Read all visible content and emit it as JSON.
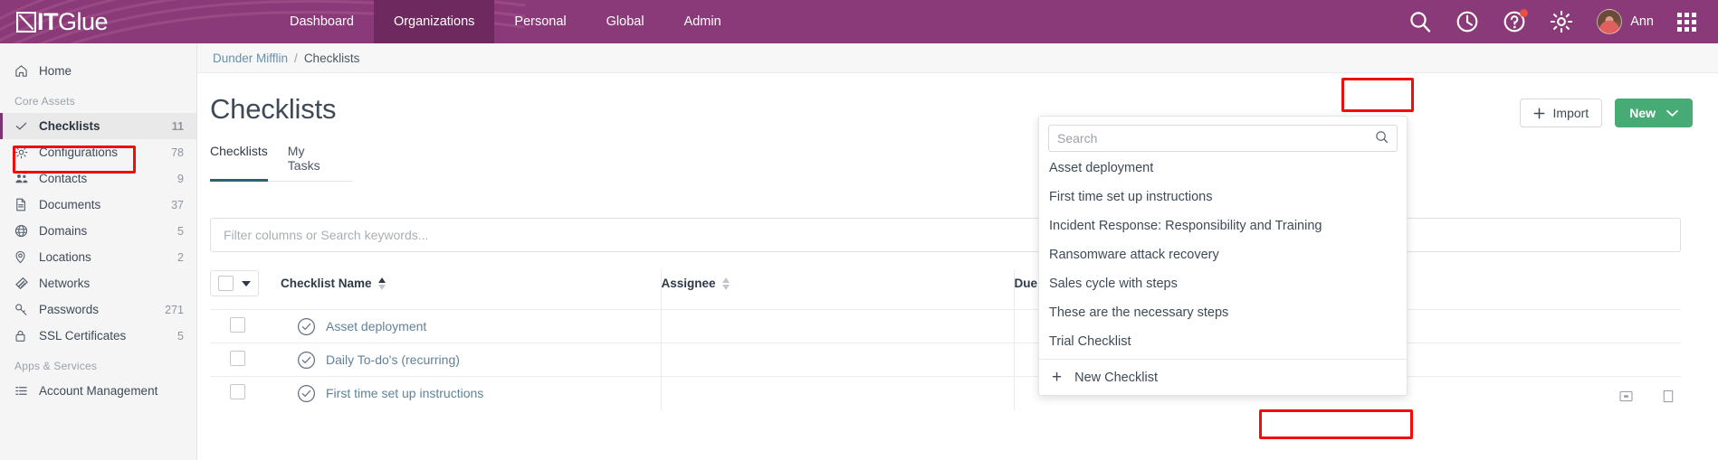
{
  "brand": {
    "name_bold": "IT",
    "name_light": "Glue",
    "accent": "#8a3a78",
    "accent_active": "#6e2a5f",
    "green": "#47ab76",
    "highlight": "#f20d0d"
  },
  "topnav": {
    "items": [
      {
        "label": "Dashboard",
        "active": false
      },
      {
        "label": "Organizations",
        "active": true
      },
      {
        "label": "Personal",
        "active": false
      },
      {
        "label": "Global",
        "active": false
      },
      {
        "label": "Admin",
        "active": false
      }
    ],
    "icons": [
      "search-icon",
      "history-icon",
      "help-icon",
      "gear-icon",
      "apps-grid-icon"
    ],
    "user_name": "Ann"
  },
  "sidebar": {
    "home": {
      "label": "Home",
      "icon": "home-icon"
    },
    "sections": [
      {
        "title": "Core Assets",
        "items": [
          {
            "label": "Checklists",
            "count": "11",
            "icon": "check-icon",
            "active": true
          },
          {
            "label": "Configurations",
            "count": "78",
            "icon": "gear-icon",
            "active": false
          },
          {
            "label": "Contacts",
            "count": "9",
            "icon": "contacts-icon",
            "active": false
          },
          {
            "label": "Documents",
            "count": "37",
            "icon": "document-icon",
            "active": false
          },
          {
            "label": "Domains",
            "count": "5",
            "icon": "globe-icon",
            "active": false
          },
          {
            "label": "Locations",
            "count": "2",
            "icon": "pin-icon",
            "active": false
          },
          {
            "label": "Networks",
            "count": "",
            "icon": "network-icon",
            "active": false
          },
          {
            "label": "Passwords",
            "count": "271",
            "icon": "key-icon",
            "active": false
          },
          {
            "label": "SSL Certificates",
            "count": "5",
            "icon": "lock-icon",
            "active": false
          }
        ]
      },
      {
        "title": "Apps & Services",
        "items": [
          {
            "label": "Account Management",
            "count": "",
            "icon": "list-icon",
            "active": false
          }
        ]
      }
    ]
  },
  "breadcrumb": {
    "org": "Dunder Mifflin",
    "separator": "/",
    "current": "Checklists"
  },
  "page": {
    "title": "Checklists"
  },
  "toolbar": {
    "import_label": "Import",
    "new_label": "New"
  },
  "tabs": [
    {
      "label": "Checklists",
      "active": true
    },
    {
      "label": "My Tasks",
      "active": false
    }
  ],
  "filter": {
    "placeholder": "Filter columns or Search keywords..."
  },
  "table": {
    "headers": [
      "Checklist Name",
      "Assignee",
      "Due"
    ],
    "rows": [
      {
        "name": "Asset deployment",
        "assignee": "",
        "due": ""
      },
      {
        "name": "Daily To-do's (recurring)",
        "assignee": "",
        "due": ""
      },
      {
        "name": "First time set up instructions",
        "assignee": "",
        "due": ""
      }
    ]
  },
  "dropdown": {
    "search_placeholder": "Search",
    "items": [
      "Asset deployment",
      "First time set up instructions",
      "Incident Response: Responsibility and Training",
      "Ransomware attack recovery",
      "Sales cycle with steps",
      "These are the necessary steps",
      "Trial Checklist"
    ],
    "footer_label": "New Checklist"
  }
}
